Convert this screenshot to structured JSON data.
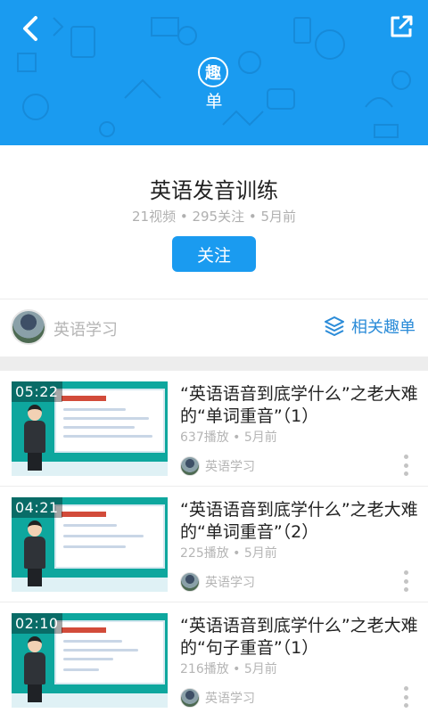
{
  "header": {
    "badge_text": "趣",
    "badge_sub": "单",
    "accent_color": "#1a9bf0"
  },
  "playlist": {
    "title": "英语发音训练",
    "meta": "21视频 • 295关注 • 5月前",
    "follow_label": "关注"
  },
  "author": {
    "name": "英语学习",
    "related_label": "相关趣单"
  },
  "videos": [
    {
      "duration": "05:22",
      "title": "“英语语音到底学什么”之老大难的“单词重音”（1）",
      "meta": "637播放 • 5月前",
      "author": "英语学习"
    },
    {
      "duration": "04:21",
      "title": "“英语语音到底学什么”之老大难的“单词重音”（2）",
      "meta": "225播放 • 5月前",
      "author": "英语学习"
    },
    {
      "duration": "02:10",
      "title": "“英语语音到底学什么”之老大难的“句子重音”（1）",
      "meta": "216播放 • 5月前",
      "author": "英语学习"
    }
  ],
  "icons": {
    "back": "chevron-left-icon",
    "share": "external-share-icon",
    "related": "layers-icon",
    "more": "more-vertical-icon"
  }
}
